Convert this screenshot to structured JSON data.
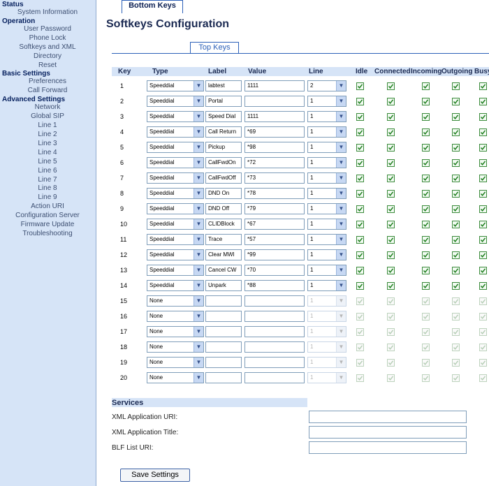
{
  "sidebar": {
    "sections": [
      {
        "title": "Status",
        "items": [
          "System Information"
        ]
      },
      {
        "title": "Operation",
        "items": [
          "User Password",
          "Phone Lock",
          "Softkeys and XML",
          "Directory",
          "Reset"
        ]
      },
      {
        "title": "Basic Settings",
        "items": [
          "Preferences",
          "Call Forward"
        ]
      },
      {
        "title": "Advanced Settings",
        "items": [
          "Network",
          "Global SIP",
          "Line 1",
          "Line 2",
          "Line 3",
          "Line 4",
          "Line 5",
          "Line 6",
          "Line 7",
          "Line 8",
          "Line 9",
          "Action URI",
          "Configuration Server",
          "Firmware Update",
          "Troubleshooting"
        ]
      }
    ]
  },
  "page": {
    "title": "Softkeys Configuration",
    "tabs": [
      "Bottom Keys",
      "Top Keys"
    ],
    "active_tab": 0
  },
  "table": {
    "headers": {
      "key": "Key",
      "type": "Type",
      "label": "Label",
      "value": "Value",
      "line": "Line",
      "idle": "Idle",
      "connected": "Connected",
      "incoming": "Incoming",
      "outgoing": "Outgoing",
      "busy": "Busy"
    },
    "rows": [
      {
        "key": "1",
        "type": "Speeddial",
        "label": "labtest",
        "value": "1111",
        "line": "2",
        "enabled": true
      },
      {
        "key": "2",
        "type": "Speeddial",
        "label": "Portal",
        "value": "",
        "line": "1",
        "enabled": true
      },
      {
        "key": "3",
        "type": "Speeddial",
        "label": "Speed Dial",
        "value": "1111",
        "line": "1",
        "enabled": true
      },
      {
        "key": "4",
        "type": "Speeddial",
        "label": "Call Return",
        "value": "*69",
        "line": "1",
        "enabled": true
      },
      {
        "key": "5",
        "type": "Speeddial",
        "label": "Pickup",
        "value": "*98",
        "line": "1",
        "enabled": true
      },
      {
        "key": "6",
        "type": "Speeddial",
        "label": "CallFwdOn",
        "value": "*72",
        "line": "1",
        "enabled": true
      },
      {
        "key": "7",
        "type": "Speeddial",
        "label": "CallFwdOff",
        "value": "*73",
        "line": "1",
        "enabled": true
      },
      {
        "key": "8",
        "type": "Speeddial",
        "label": "DND On",
        "value": "*78",
        "line": "1",
        "enabled": true
      },
      {
        "key": "9",
        "type": "Speeddial",
        "label": "DND Off",
        "value": "*79",
        "line": "1",
        "enabled": true
      },
      {
        "key": "10",
        "type": "Speeddial",
        "label": "CLIDBlock",
        "value": "*67",
        "line": "1",
        "enabled": true
      },
      {
        "key": "11",
        "type": "Speeddial",
        "label": "Trace",
        "value": "*57",
        "line": "1",
        "enabled": true
      },
      {
        "key": "12",
        "type": "Speeddial",
        "label": "Clear MWI",
        "value": "*99",
        "line": "1",
        "enabled": true
      },
      {
        "key": "13",
        "type": "Speeddial",
        "label": "Cancel CW",
        "value": "*70",
        "line": "1",
        "enabled": true
      },
      {
        "key": "14",
        "type": "Speeddial",
        "label": "Unpark",
        "value": "*88",
        "line": "1",
        "enabled": true
      },
      {
        "key": "15",
        "type": "None",
        "label": "",
        "value": "",
        "line": "1",
        "enabled": false
      },
      {
        "key": "16",
        "type": "None",
        "label": "",
        "value": "",
        "line": "1",
        "enabled": false
      },
      {
        "key": "17",
        "type": "None",
        "label": "",
        "value": "",
        "line": "1",
        "enabled": false
      },
      {
        "key": "18",
        "type": "None",
        "label": "",
        "value": "",
        "line": "1",
        "enabled": false
      },
      {
        "key": "19",
        "type": "None",
        "label": "",
        "value": "",
        "line": "1",
        "enabled": false
      },
      {
        "key": "20",
        "type": "None",
        "label": "",
        "value": "",
        "line": "1",
        "enabled": false
      }
    ]
  },
  "services": {
    "title": "Services",
    "fields": [
      {
        "label": "XML Application URI:",
        "value": ""
      },
      {
        "label": "XML Application Title:",
        "value": ""
      },
      {
        "label": "BLF List URI:",
        "value": ""
      }
    ]
  },
  "save_label": "Save Settings",
  "icons": {
    "dropdown": "chevron-down-icon",
    "check": "checkmark-icon"
  },
  "colors": {
    "sidebar_bg": "#d6e4f7",
    "header_bg": "#d6e4f7",
    "tab_border": "#2b60b8",
    "check": "#1e7d1e"
  }
}
